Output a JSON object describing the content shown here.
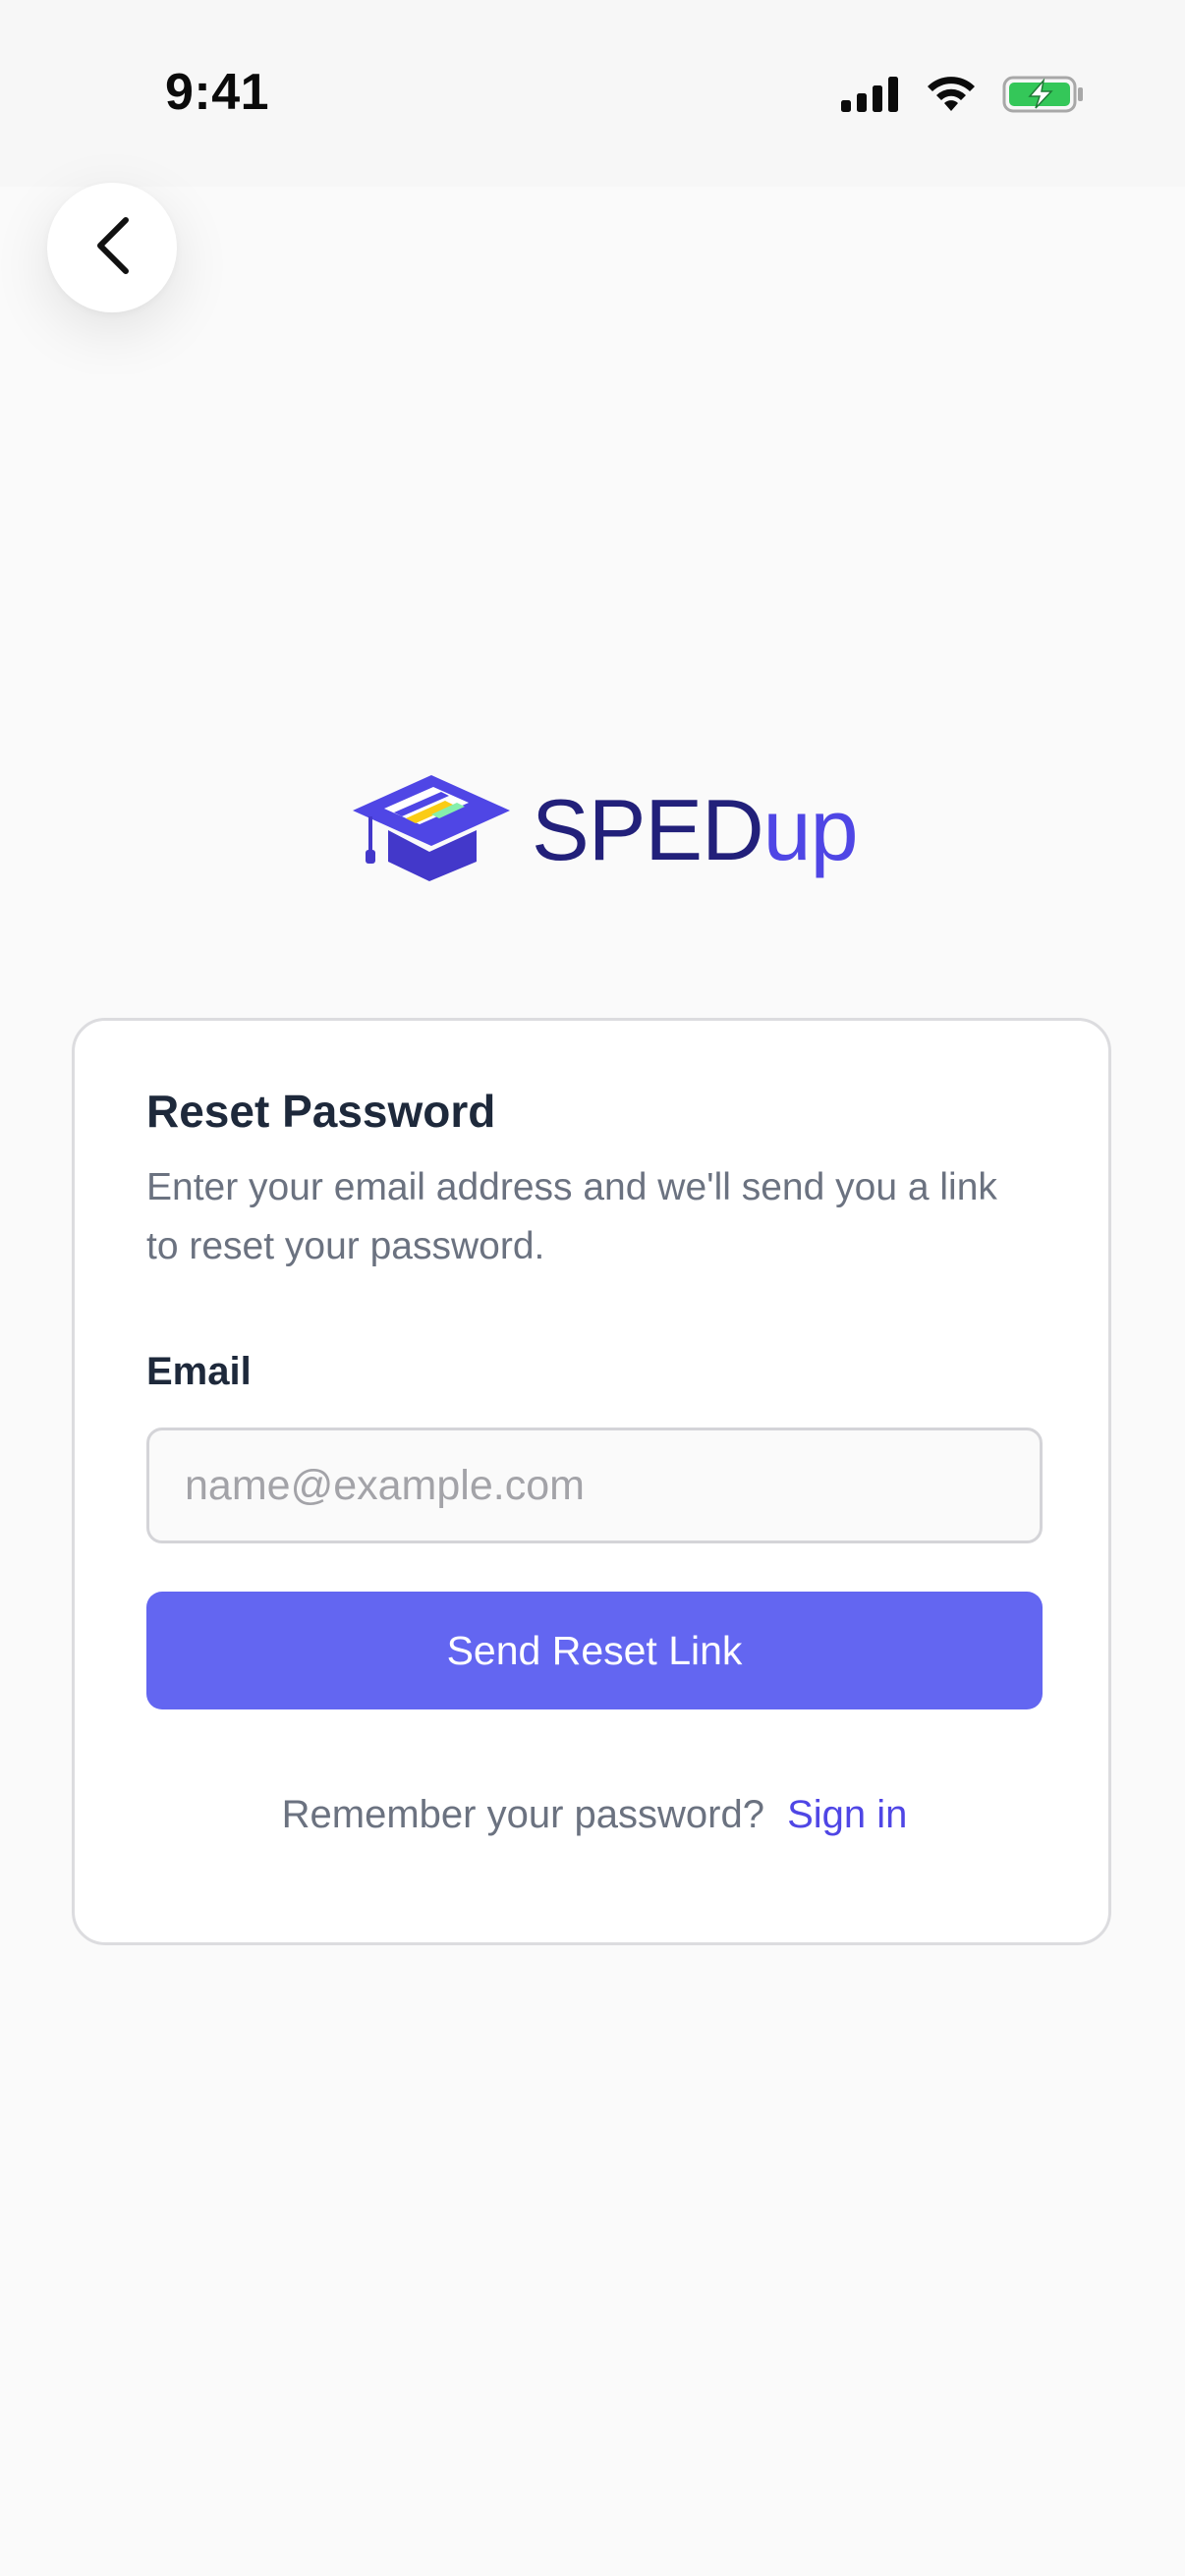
{
  "status_bar": {
    "time": "9:41",
    "icons": [
      "cellular-signal-icon",
      "wifi-icon",
      "battery-charging-icon"
    ]
  },
  "nav": {
    "back_icon": "chevron-left-icon"
  },
  "logo": {
    "icon": "graduation-cap-icon",
    "text_part1": "SPED",
    "text_part2": "up"
  },
  "card": {
    "title": "Reset Password",
    "description": "Enter your email address and we'll send you a link to reset your password.",
    "email_label": "Email",
    "email_placeholder": "name@example.com",
    "email_value": "",
    "submit_label": "Send Reset Link",
    "signin_prompt": "Remember your password?",
    "signin_link": "Sign in"
  },
  "colors": {
    "background": "#fafafa",
    "primary": "#6366f1",
    "link": "#4f46e5",
    "logo_dark": "#22207a",
    "battery_green": "#34c759"
  }
}
